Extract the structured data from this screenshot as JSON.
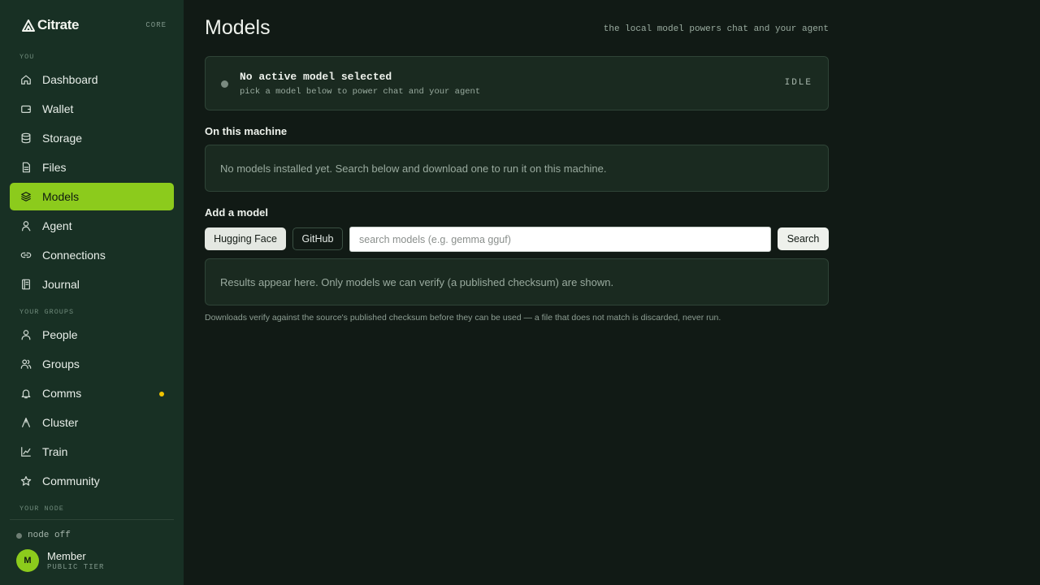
{
  "brand": {
    "name": "Citrate",
    "tag": "CORE"
  },
  "sidebar": {
    "sections": {
      "you": "YOU",
      "groups": "YOUR GROUPS",
      "node": "YOUR NODE"
    },
    "items": [
      {
        "label": "Dashboard",
        "icon": "home-icon"
      },
      {
        "label": "Wallet",
        "icon": "wallet-icon"
      },
      {
        "label": "Storage",
        "icon": "database-icon"
      },
      {
        "label": "Files",
        "icon": "file-icon"
      },
      {
        "label": "Models",
        "icon": "layers-icon",
        "active": true
      },
      {
        "label": "Agent",
        "icon": "agent-icon"
      },
      {
        "label": "Connections",
        "icon": "link-icon"
      },
      {
        "label": "Journal",
        "icon": "journal-icon"
      },
      {
        "label": "People",
        "icon": "person-icon"
      },
      {
        "label": "Groups",
        "icon": "group-icon"
      },
      {
        "label": "Comms",
        "icon": "bell-icon",
        "badge": "notification"
      },
      {
        "label": "Cluster",
        "icon": "cluster-icon"
      },
      {
        "label": "Train",
        "icon": "chart-icon"
      },
      {
        "label": "Community",
        "icon": "star-icon"
      }
    ],
    "node_status": "node off",
    "user": {
      "initial": "M",
      "name": "Member",
      "tier": "PUBLIC TIER"
    }
  },
  "main": {
    "title": "Models",
    "hint": "the local model powers chat and your agent",
    "status": {
      "title": "No active model selected",
      "subtitle": "pick a model below to power chat and your agent",
      "badge": "IDLE"
    },
    "machine": {
      "heading": "On this machine",
      "empty": "No models installed yet. Search below and download one to run it on this machine."
    },
    "add": {
      "heading": "Add a model",
      "sources": [
        "Hugging Face",
        "GitHub"
      ],
      "search_placeholder": "search models (e.g. gemma gguf)",
      "search_button": "Search",
      "results_placeholder": "Results appear here. Only models we can verify (a published checksum) are shown."
    },
    "footnote": "Downloads verify against the source's published checksum before they can be used — a file that does not match is discarded, never run."
  },
  "colors": {
    "accent": "#8ccb1c",
    "background": "#111a15",
    "sidebar": "#183024",
    "notify": "#f0c400"
  }
}
